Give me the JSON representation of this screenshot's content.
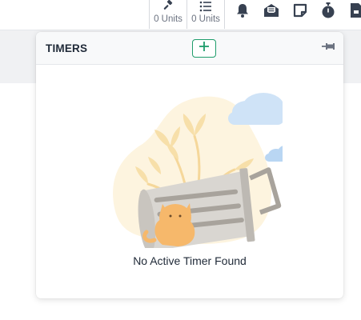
{
  "topbar": {
    "units": [
      {
        "icon": "gavel-icon",
        "label": "0 Units"
      },
      {
        "icon": "list-icon",
        "label": "0 Units"
      }
    ],
    "icons": [
      "bell-icon",
      "envelope-open-icon",
      "sticky-note-icon",
      "stopwatch-icon",
      "file-icon"
    ]
  },
  "timers_panel": {
    "title": "TIMERS",
    "add_icon": "plus-icon",
    "pin_icon": "pin-icon",
    "empty_message": "No Active Timer Found",
    "accent_color": "#1f9d6b"
  }
}
